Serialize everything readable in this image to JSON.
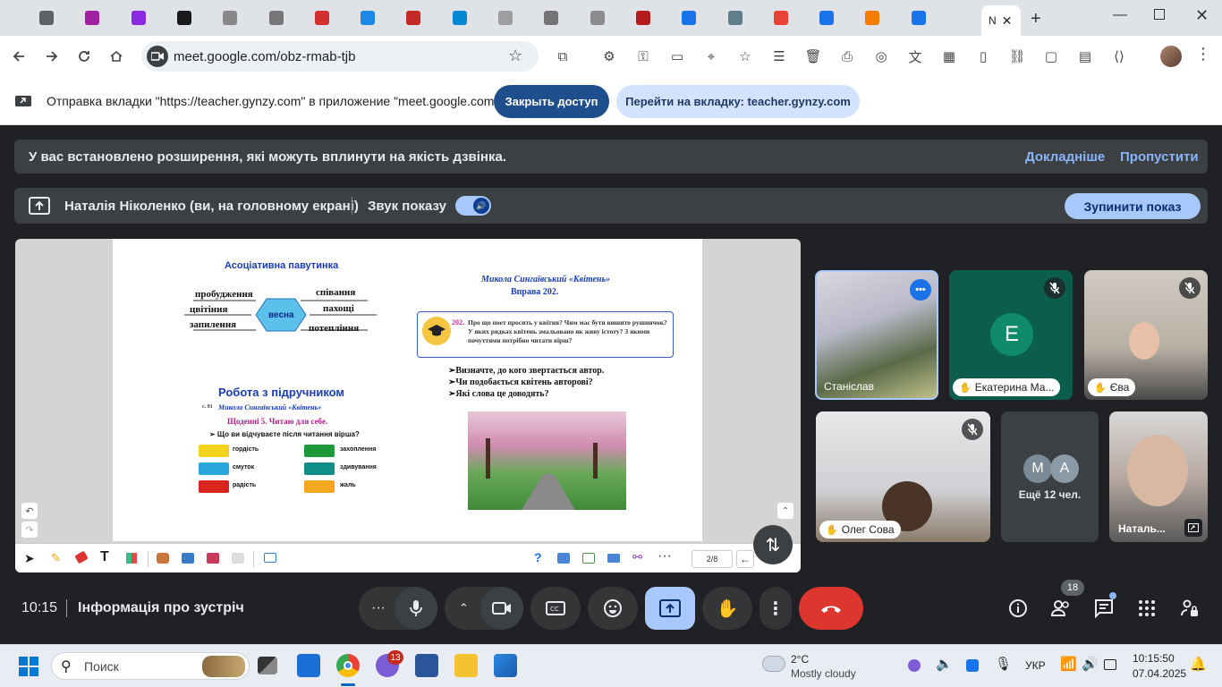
{
  "browser": {
    "active_tab_label": "N",
    "url": "meet.google.com/obz-rmab-tjb",
    "tab_count_colors": [
      "#5f6368",
      "#a020a0",
      "#8a2be2",
      "#1a1a1a",
      "#888888",
      "#777777",
      "#d32f2f",
      "#1e88e5",
      "#c62828",
      "#0288d1",
      "#9e9e9e",
      "#757575",
      "#8d8d8d",
      "#b71c1c",
      "#1a73e8",
      "#607d8b",
      "#ea4335",
      "#1a73e8",
      "#f57c00",
      "#1a73e8"
    ]
  },
  "sharebar": {
    "message": "Отправка вкладки \"https://teacher.gynzy.com\" в приложение \"meet.google.com\"...",
    "stop_button": "Закрыть доступ",
    "goto_button": "Перейти на вкладку: teacher.gynzy.com"
  },
  "warning": {
    "text": "У вас встановлено розширення, які можуть вплинути на якість дзвінка.",
    "learn_more": "Докладніше",
    "skip": "Пропустити"
  },
  "presenting": {
    "label": "Наталія Ніколенко (ви, на головному екрані)",
    "sound_label": "Звук показу",
    "stop_button": "Зупинити показ"
  },
  "slide": {
    "web_title": "Асоціативна павутинка",
    "center_word": "весна",
    "words": [
      "пробудження",
      "співання",
      "цвітіння",
      "пахощі",
      "запилення",
      "потепління"
    ],
    "poem_title": "Микола Сингаївський «Квітень»",
    "exercise": "Вправа 202.",
    "task_number": "202.",
    "task_text": "Про що поет просить у квітня? Чим має бути вишито рушничок? У яких рядках квітень змальовано як живу істоту? З якими почуттями потрібно читати вірш?",
    "questions": [
      "➢Визначте, до кого звертається автор.",
      "➢Чи подобається квітень авторові?",
      "➢Які слова це доводять?"
    ],
    "textbook_title": "Робота з підручником",
    "page_ref": "с. 91",
    "diary": "Щоденні 5. Читаю для себе.",
    "feel_question": "➢  Що ви відчуваєте після читання вірша?",
    "feelings_left": [
      "гордість",
      "смуток",
      "радість"
    ],
    "feelings_right": [
      "захоплення",
      "здивування",
      "жаль"
    ],
    "page_counter": "2/8"
  },
  "participants": {
    "stanislav": "Станіслав",
    "kateryna": "Екатерина Ма...",
    "kateryna_initial": "E",
    "eva": "Єва",
    "oleg": "Олег Сова",
    "more_initials": [
      "M",
      "A"
    ],
    "more_label": "Ещё 12 чел.",
    "natalia": "Наталь..."
  },
  "meeting": {
    "time": "10:15",
    "info": "Інформація про зустріч",
    "people_count": "18"
  },
  "taskbar": {
    "search_placeholder": "Поиск",
    "teams_badge": "13",
    "weather_temp": "2°C",
    "weather_desc": "Mostly cloudy",
    "lang": "УКР",
    "clock_time": "10:15:50",
    "clock_date": "07.04.2025"
  },
  "colors": {
    "meet_bg": "#202124",
    "accent_blue": "#a8c7fa",
    "share_blue": "#1f4e8c",
    "end_call_red": "#dc362e",
    "link_blue": "#8ab4f8"
  }
}
